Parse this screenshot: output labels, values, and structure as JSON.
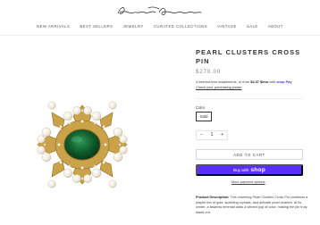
{
  "header": {
    "logo_alt": "Kenneth Jay Lane signature logo",
    "nav": [
      "NEW ARRIVALS",
      "BEST SELLERS",
      "JEWELRY",
      "CURATED COLLECTIONS",
      "VINTAGE",
      "SALE",
      "ABOUT"
    ]
  },
  "product": {
    "title": "PEARL CLUSTERS CROSS PIN",
    "price": "$270.00",
    "installments": {
      "prefix": "4 interest-free installments, or from ",
      "amount": "$4.37 $/mo",
      "suffix": " with ",
      "brand": "shop Pay",
      "link": "Check your purchasing power"
    },
    "color_label": "Color",
    "color_value": "Gold",
    "quantity": {
      "minus": "−",
      "value": "1",
      "plus": "+"
    },
    "add_to_cart": "ADD TO CART",
    "buy_with": "Buy with",
    "shop_word": "shop",
    "more_payment": "More payment options",
    "description_label": "Product Description:",
    "description": " This charming Pearl Clusters Cross Pin combines a playful mix of gold, sparkling crystals, and delicate pearl clusters. At its center, a flawless emerald adds a vibrant pop of color, making the pin truly stand out."
  },
  "colors": {
    "shop_pay": "#5a31f4",
    "gold": "#c9a24a",
    "emerald": "#0f5a2c"
  }
}
